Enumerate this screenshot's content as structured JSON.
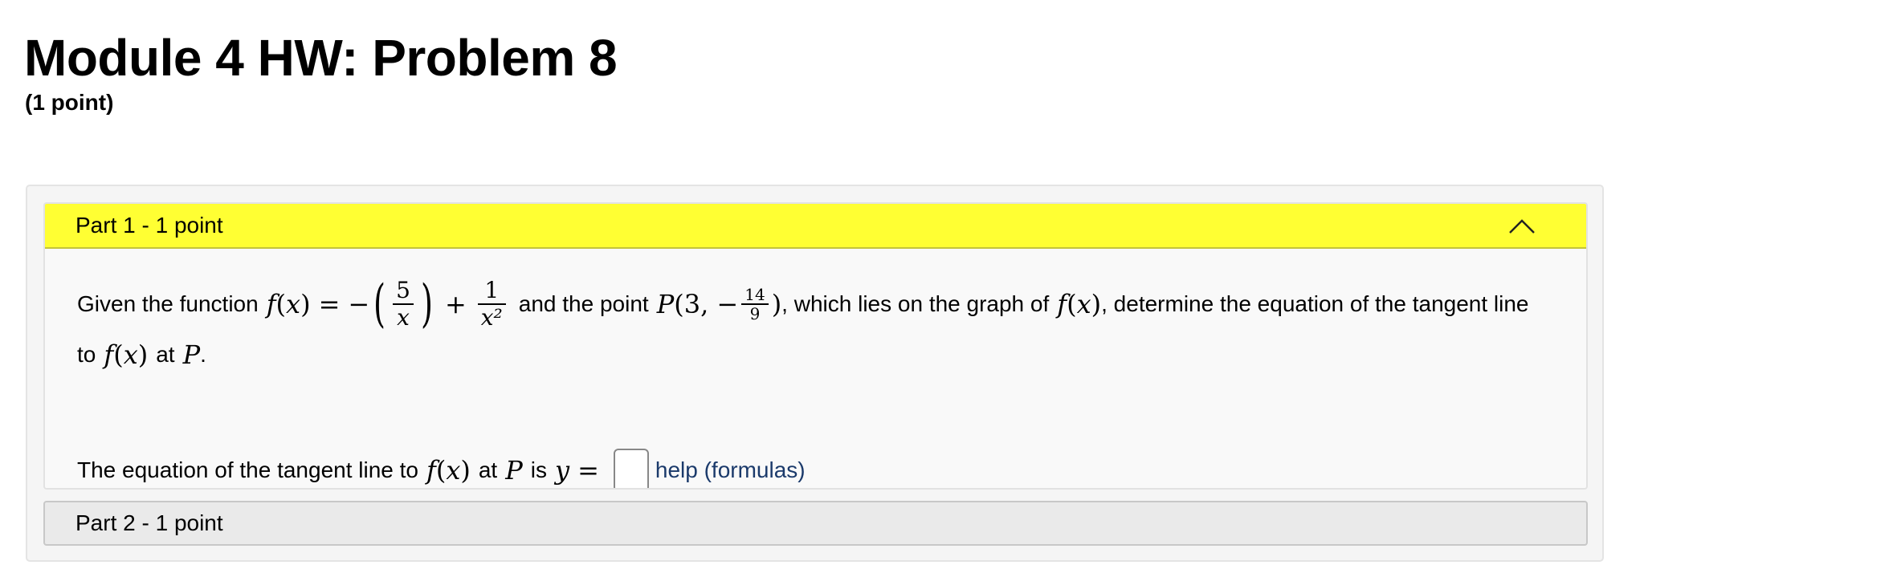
{
  "page": {
    "title": "Module 4 HW: Problem 8",
    "points": "(1 point)"
  },
  "part1": {
    "header": "Part 1 - 1 point",
    "collapse_icon": "chevron-up-icon",
    "header_color": "#ffff33",
    "text_given": "Given the function",
    "fn": "f",
    "var": "x",
    "frac1_num": "5",
    "frac1_den": "x",
    "frac2_num": "1",
    "frac2_den": "x²",
    "text_and_point": "and the point",
    "point_name": "P",
    "point_x": "3",
    "point_y_num": "14",
    "point_y_den": "9",
    "text_lies_on": ", which lies on the graph of",
    "text_determine": ", determine the equation of the tangent line",
    "text_to": "to",
    "text_at": "at",
    "text_period": ".",
    "text_equation": "The equation of the tangent line to",
    "text_is": "is",
    "y_var": "y",
    "answer_value": "",
    "help_link": "help (formulas)"
  },
  "part2": {
    "header": "Part 2 - 1 point"
  }
}
